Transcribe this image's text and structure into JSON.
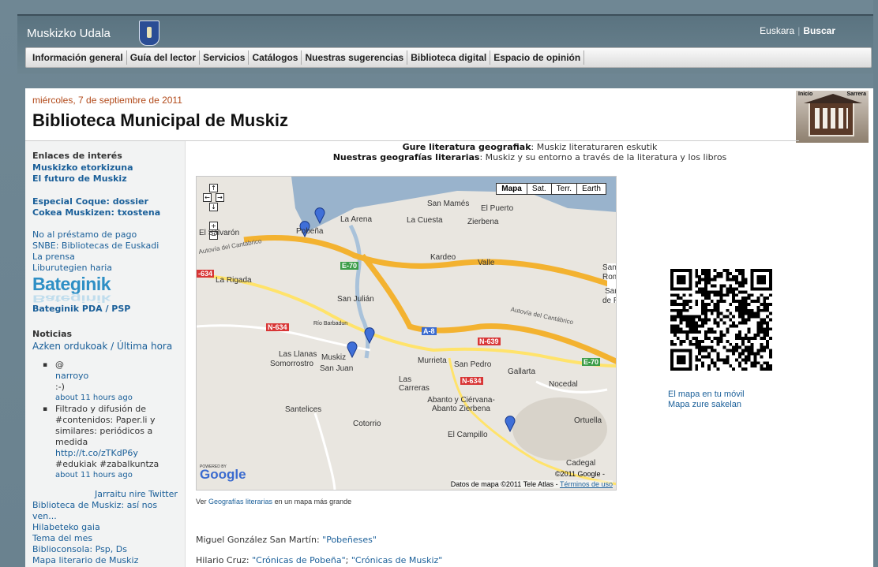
{
  "header": {
    "site_title": "Muskizko Udala",
    "lang_link": "Euskara",
    "search_link": "Buscar",
    "menu": [
      "Información general",
      "Guía del lector",
      "Servicios",
      "Catálogos",
      "Nuestras sugerencias",
      "Biblioteca digital",
      "Espacio de opinión"
    ]
  },
  "blog": {
    "date": "miércoles, 7 de septiembre de 2011",
    "title": "Biblioteca Municipal de Muskiz",
    "header_image": {
      "left_label": "Inicio",
      "right_label": "Sarrera"
    }
  },
  "sidebar": {
    "links_heading": "Enlaces de interés",
    "bold_links": [
      "Muskizko etorkizuna",
      "El futuro de Muskiz",
      "Especial Coque: dossier",
      "Cokea Muskizen: txostena"
    ],
    "links": [
      "No al préstamo de pago",
      "SNBE: Bibliotecas de Euskadi",
      "La prensa",
      "Liburutegien haria"
    ],
    "bateginik_logo": "Bateginik",
    "bateginik_link": "Bateginik PDA / PSP",
    "news_heading": "Noticias",
    "news_sub": "Azken ordukoak / Última hora",
    "tweets": [
      {
        "lines": [
          "@",
          "narroyo",
          ":-)"
        ],
        "time": "about 11 hours ago"
      },
      {
        "lines": [
          "Filtrado y difusión de",
          "#contenidos: Paper.li y",
          "similares: periódicos a",
          "medida"
        ],
        "link": "http://t.co/zTKdP6y",
        "tags": "#edukiak #zabalkuntza",
        "time": "about 11 hours ago"
      }
    ],
    "twitter_follow": "Jarraitu nire Twitter",
    "more_links": [
      "Biblioteca de Muskiz: así nos",
      "ven...",
      "Hilabeteko gaia",
      "Tema del mes",
      "Biblioconsola: Psp, Ds",
      "Mapa literario de Muskiz"
    ]
  },
  "content": {
    "heading_bold_1": "Gure literatura geografiak",
    "heading_rest_1": ": Muskiz literaturaren eskutik",
    "heading_bold_2": "Nuestras geografías literarias",
    "heading_rest_2": ": Muskiz y su entorno a través de la literatura y los libros",
    "ver_prefix": "Ver ",
    "ver_link": "Geografías literarias",
    "ver_suffix": " en un mapa más grande",
    "qr_line1": "El mapa en tu móvil",
    "qr_line2": "Mapa zure sakelan",
    "books": [
      {
        "author": "Miguel González San Martín: ",
        "title": "\"Pobeñeses\""
      },
      {
        "author": "Hilario Cruz: ",
        "title": "\"Crónicas de Pobeña\"",
        "sep": "; ",
        "title2": "\"Crónicas de Muskiz\""
      }
    ]
  },
  "map": {
    "tabs": [
      "Mapa",
      "Sat.",
      "Terr.",
      "Earth"
    ],
    "active_tab": "Mapa",
    "places": [
      "San Mamés",
      "El Puerto",
      "La Arena",
      "La Cuesta",
      "Zierbena",
      "Pobeña",
      "El Salvarón",
      "Kardeo",
      "Valle",
      "La Rigada",
      "San Julián",
      "Río Barbadun",
      "Las Llanas",
      "Somorrostro",
      "Muskiz",
      "San Juan",
      "Murrieta",
      "San Pedro",
      "Gallarta",
      "Las Carreras",
      "Nocedal",
      "Abanto y Ciérvana-Abanto Zierbena",
      "Santelices",
      "Cotorrio",
      "El Campillo",
      "Ortuella",
      "Cadegal",
      "San",
      "Rom",
      "San",
      "de R"
    ],
    "roads": [
      "Autovía del Cantábrico",
      "E-70",
      "N-634",
      "A-8",
      "N-639",
      "Autovía del Cantábrico",
      "N-634",
      "-634",
      "E-70"
    ],
    "powered_by": "POWERED BY",
    "logo": "Google",
    "copyright": "©2011 Google -",
    "data_text": "Datos de mapa ©2011 Tele Atlas - ",
    "terms": "Términos de uso"
  }
}
